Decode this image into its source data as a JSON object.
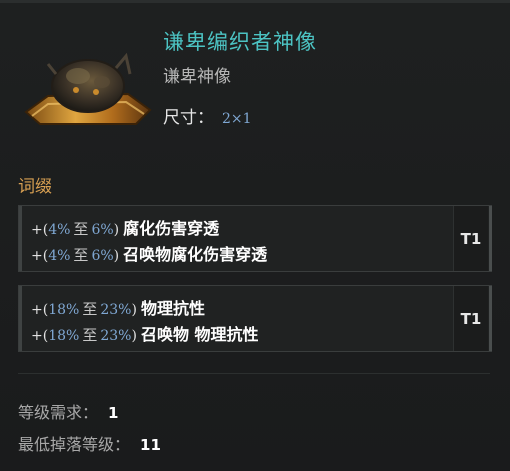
{
  "item": {
    "name": "谦卑编织者神像",
    "type": "谦卑神像",
    "size_label": "尺寸：",
    "size_value": "2×1"
  },
  "affix_section": {
    "title": "词缀",
    "groups": [
      {
        "tier": "T1",
        "lines": [
          {
            "plus": "+",
            "open": "(",
            "min": "4%",
            "to": "至",
            "max": "6%",
            "close": ")",
            "name": "腐化伤害穿透"
          },
          {
            "plus": "+",
            "open": "(",
            "min": "4%",
            "to": "至",
            "max": "6%",
            "close": ")",
            "name": "召唤物腐化伤害穿透"
          }
        ]
      },
      {
        "tier": "T1",
        "lines": [
          {
            "plus": "+",
            "open": "(",
            "min": "18%",
            "to": "至",
            "max": "23%",
            "close": ")",
            "name": "物理抗性"
          },
          {
            "plus": "+",
            "open": "(",
            "min": "18%",
            "to": "至",
            "max": "23%",
            "close": ")",
            "name": "召唤物 物理抗性"
          }
        ]
      }
    ]
  },
  "requirements": {
    "level_label": "等级需求：",
    "level_value": "1",
    "drop_label": "最低掉落等级：",
    "drop_value": "11"
  },
  "colors": {
    "name": "#4cc3c3",
    "affix_title": "#d8a052",
    "range_number": "#7fa7d2",
    "background": "#1a1b1c"
  },
  "icons": {
    "item_image": "idol-statue-icon"
  }
}
